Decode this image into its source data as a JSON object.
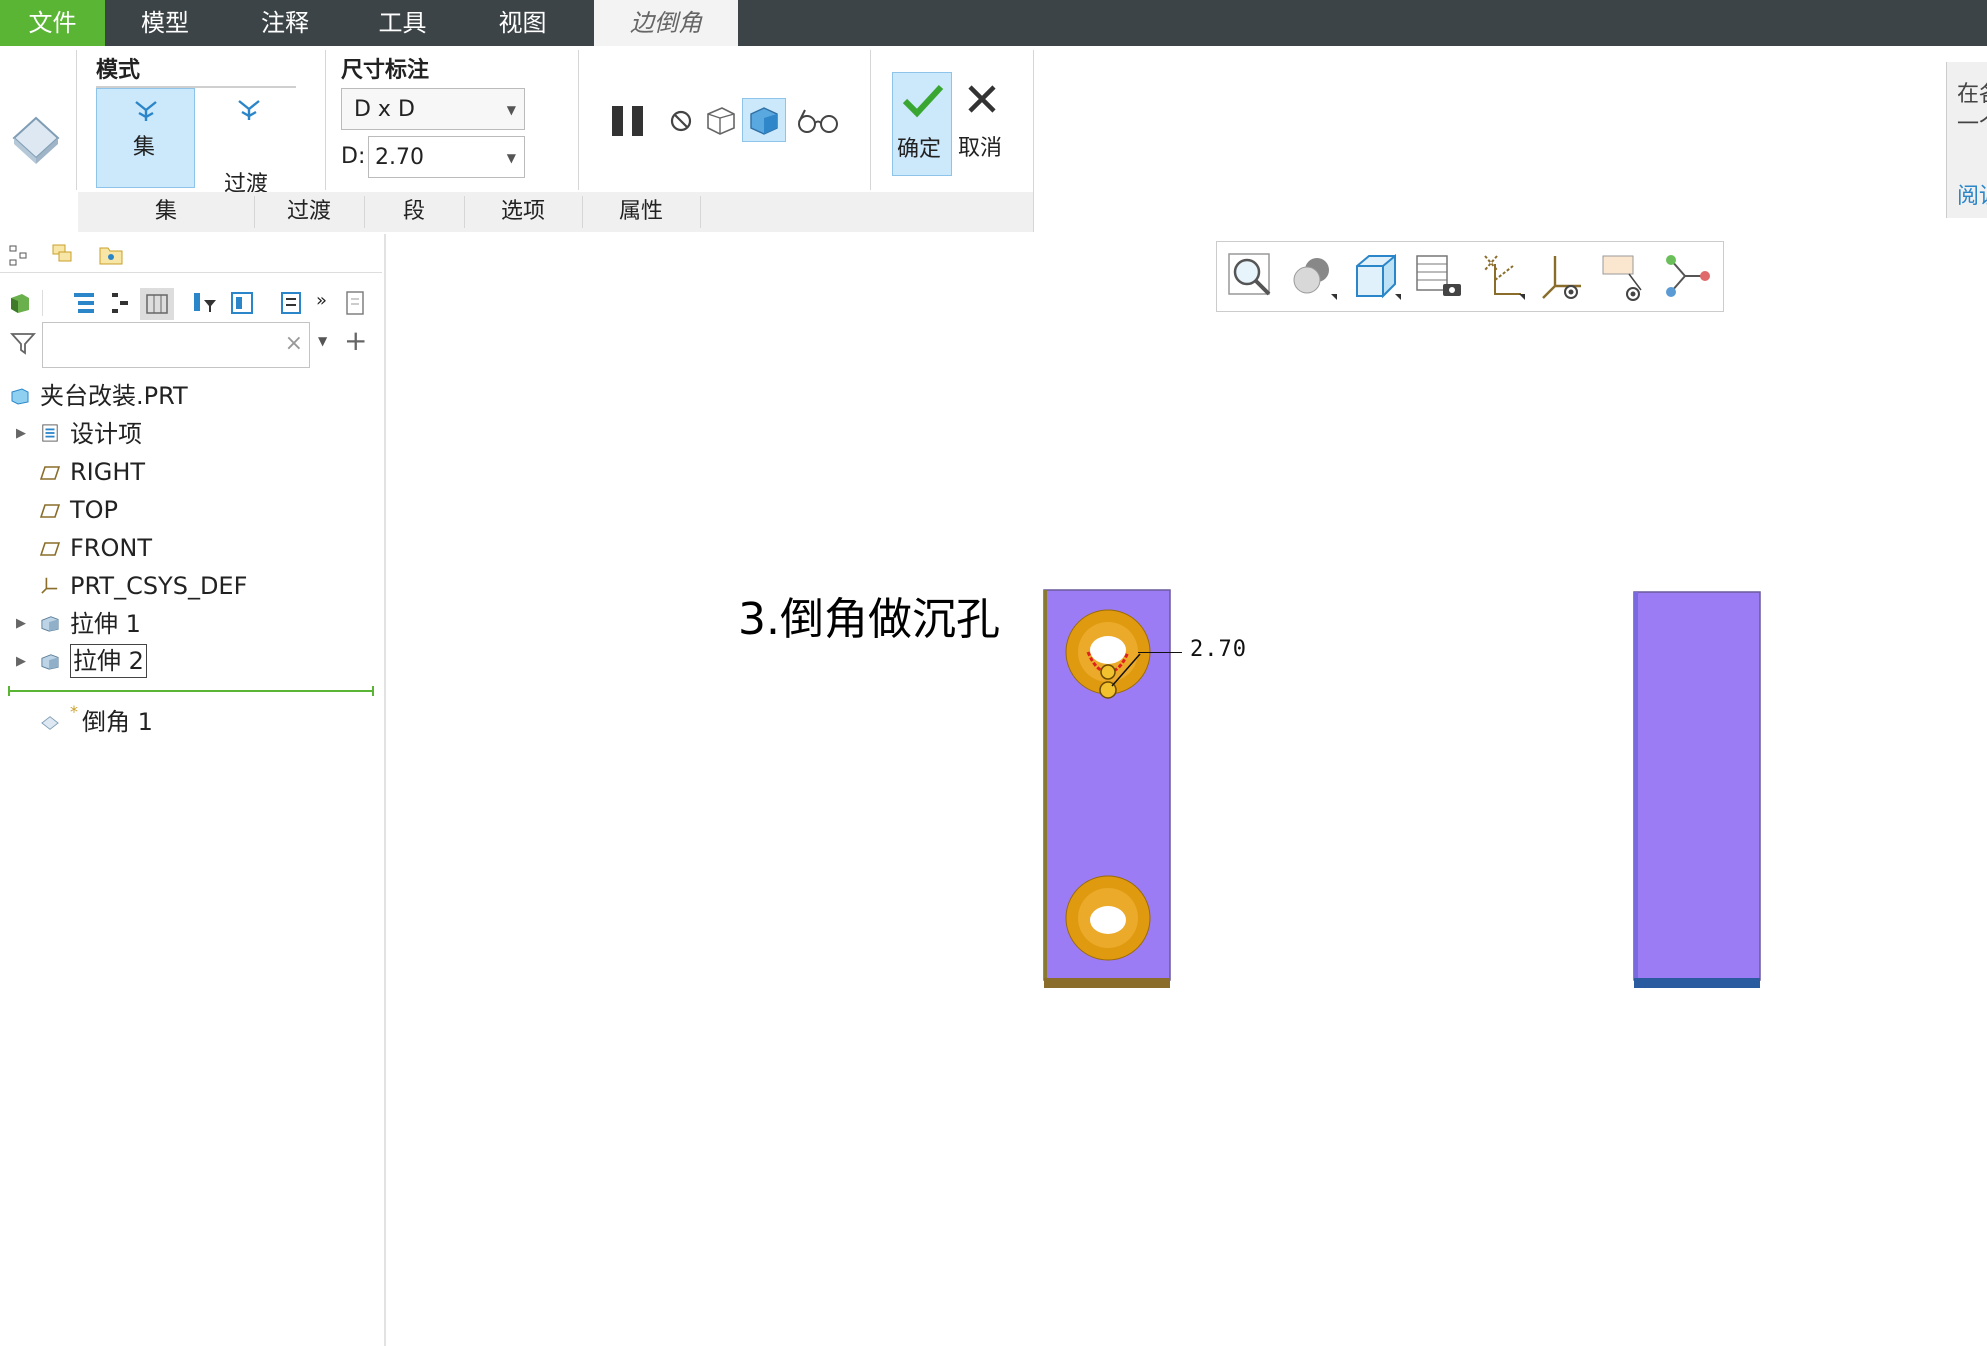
{
  "menu": {
    "file": "文件",
    "model": "模型",
    "annotate": "注释",
    "tools": "工具",
    "view": "视图",
    "active_tab": "边倒角"
  },
  "ribbon": {
    "mode_group": "模式",
    "mode_set": "集",
    "mode_transition": "过渡",
    "dim_group": "尺寸标注",
    "dim_scheme": "D x D",
    "d_label": "D:",
    "d_value": "2.70",
    "confirm": "确定",
    "cancel": "取消",
    "tabs": [
      "集",
      "过渡",
      "段",
      "选项",
      "属性"
    ],
    "side_text_1": "在各",
    "side_text_2": "一个",
    "side_link": "阅读"
  },
  "tree": {
    "search_placeholder": "",
    "root": "夹台改装.PRT",
    "items": [
      "设计项",
      "RIGHT",
      "TOP",
      "FRONT",
      "PRT_CSYS_DEF",
      "拉伸 1",
      "拉伸 2"
    ],
    "new_feature": "倒角 1",
    "new_marker": "*"
  },
  "viewport": {
    "annotation": "3.倒角做沉孔",
    "dimension": "2.70"
  },
  "colors": {
    "accent_green": "#5ab535",
    "menubar": "#3d4447",
    "part_face": "#9b7cf4",
    "countersink": "#e09a10"
  }
}
